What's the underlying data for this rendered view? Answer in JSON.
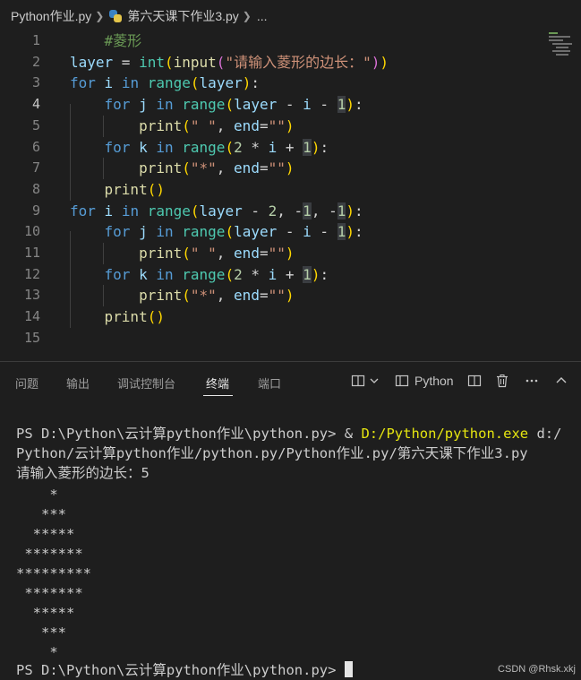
{
  "breadcrumb": {
    "folder": "Python作业.py",
    "file_icon": "python-file-icon",
    "file": "第六天课下作业3.py",
    "ellipsis": "..."
  },
  "editor": {
    "active_line": 4,
    "lines": [
      {
        "n": "1",
        "tokens": [
          [
            "    ",
            ""
          ],
          [
            "#菱形",
            "cm"
          ]
        ]
      },
      {
        "n": "2",
        "tokens": [
          [
            "layer",
            "var"
          ],
          [
            " = ",
            ""
          ],
          [
            "int",
            "bi"
          ],
          [
            "(",
            "br1"
          ],
          [
            "input",
            "fn"
          ],
          [
            "(",
            "br2"
          ],
          [
            "\"请输入菱形的边长：\"",
            "str"
          ],
          [
            ")",
            "br2"
          ],
          [
            ")",
            "br1"
          ]
        ]
      },
      {
        "n": "3",
        "tokens": [
          [
            "for",
            "kw"
          ],
          [
            " ",
            ""
          ],
          [
            "i",
            "var"
          ],
          [
            " ",
            ""
          ],
          [
            "in",
            "kw"
          ],
          [
            " ",
            ""
          ],
          [
            "range",
            "bi"
          ],
          [
            "(",
            "br1"
          ],
          [
            "layer",
            "var"
          ],
          [
            ")",
            "br1"
          ],
          [
            ":",
            ""
          ]
        ]
      },
      {
        "n": "4",
        "tokens": [
          [
            "    ",
            ""
          ],
          [
            "for",
            "kw"
          ],
          [
            " ",
            ""
          ],
          [
            "j",
            "var"
          ],
          [
            " ",
            ""
          ],
          [
            "in",
            "kw"
          ],
          [
            " ",
            ""
          ],
          [
            "range",
            "bi"
          ],
          [
            "(",
            "br1"
          ],
          [
            "layer",
            "var"
          ],
          [
            " - ",
            ""
          ],
          [
            "i",
            "var"
          ],
          [
            " - ",
            ""
          ],
          [
            "1",
            "num-hl num"
          ],
          [
            ")",
            "br1"
          ],
          [
            ":",
            ""
          ]
        ]
      },
      {
        "n": "5",
        "tokens": [
          [
            "        ",
            ""
          ],
          [
            "print",
            "fn"
          ],
          [
            "(",
            "br1"
          ],
          [
            "\" \"",
            "str"
          ],
          [
            ", ",
            ""
          ],
          [
            "end",
            "var"
          ],
          [
            "=",
            ""
          ],
          [
            "\"\"",
            "str"
          ],
          [
            ")",
            "br1"
          ]
        ]
      },
      {
        "n": "6",
        "tokens": [
          [
            "    ",
            ""
          ],
          [
            "for",
            "kw"
          ],
          [
            " ",
            ""
          ],
          [
            "k",
            "var"
          ],
          [
            " ",
            ""
          ],
          [
            "in",
            "kw"
          ],
          [
            " ",
            ""
          ],
          [
            "range",
            "bi"
          ],
          [
            "(",
            "br1"
          ],
          [
            "2",
            "num"
          ],
          [
            " * ",
            ""
          ],
          [
            "i",
            "var"
          ],
          [
            " + ",
            ""
          ],
          [
            "1",
            "num-hl num"
          ],
          [
            ")",
            "br1"
          ],
          [
            ":",
            ""
          ]
        ]
      },
      {
        "n": "7",
        "tokens": [
          [
            "        ",
            ""
          ],
          [
            "print",
            "fn"
          ],
          [
            "(",
            "br1"
          ],
          [
            "\"*\"",
            "str"
          ],
          [
            ", ",
            ""
          ],
          [
            "end",
            "var"
          ],
          [
            "=",
            ""
          ],
          [
            "\"\"",
            "str"
          ],
          [
            ")",
            "br1"
          ]
        ]
      },
      {
        "n": "8",
        "tokens": [
          [
            "    ",
            ""
          ],
          [
            "print",
            "fn"
          ],
          [
            "(",
            "br1"
          ],
          [
            ")",
            "br1"
          ]
        ]
      },
      {
        "n": "9",
        "tokens": [
          [
            "for",
            "kw"
          ],
          [
            " ",
            ""
          ],
          [
            "i",
            "var"
          ],
          [
            " ",
            ""
          ],
          [
            "in",
            "kw"
          ],
          [
            " ",
            ""
          ],
          [
            "range",
            "bi"
          ],
          [
            "(",
            "br1"
          ],
          [
            "layer",
            "var"
          ],
          [
            " - ",
            ""
          ],
          [
            "2",
            "num"
          ],
          [
            ", ",
            ""
          ],
          [
            "-",
            ""
          ],
          [
            "1",
            "num-hl num"
          ],
          [
            ", ",
            ""
          ],
          [
            "-",
            ""
          ],
          [
            "1",
            "num-hl num"
          ],
          [
            ")",
            "br1"
          ],
          [
            ":",
            ""
          ]
        ]
      },
      {
        "n": "10",
        "tokens": [
          [
            "    ",
            ""
          ],
          [
            "for",
            "kw"
          ],
          [
            " ",
            ""
          ],
          [
            "j",
            "var"
          ],
          [
            " ",
            ""
          ],
          [
            "in",
            "kw"
          ],
          [
            " ",
            ""
          ],
          [
            "range",
            "bi"
          ],
          [
            "(",
            "br1"
          ],
          [
            "layer",
            "var"
          ],
          [
            " - ",
            ""
          ],
          [
            "i",
            "var"
          ],
          [
            " - ",
            ""
          ],
          [
            "1",
            "num-hl num"
          ],
          [
            ")",
            "br1"
          ],
          [
            ":",
            ""
          ]
        ]
      },
      {
        "n": "11",
        "tokens": [
          [
            "        ",
            ""
          ],
          [
            "print",
            "fn"
          ],
          [
            "(",
            "br1"
          ],
          [
            "\" \"",
            "str"
          ],
          [
            ", ",
            ""
          ],
          [
            "end",
            "var"
          ],
          [
            "=",
            ""
          ],
          [
            "\"\"",
            "str"
          ],
          [
            ")",
            "br1"
          ]
        ]
      },
      {
        "n": "12",
        "tokens": [
          [
            "    ",
            ""
          ],
          [
            "for",
            "kw"
          ],
          [
            " ",
            ""
          ],
          [
            "k",
            "var"
          ],
          [
            " ",
            ""
          ],
          [
            "in",
            "kw"
          ],
          [
            " ",
            ""
          ],
          [
            "range",
            "bi"
          ],
          [
            "(",
            "br1"
          ],
          [
            "2",
            "num"
          ],
          [
            " * ",
            ""
          ],
          [
            "i",
            "var"
          ],
          [
            " + ",
            ""
          ],
          [
            "1",
            "num-hl num"
          ],
          [
            ")",
            "br1"
          ],
          [
            ":",
            ""
          ]
        ]
      },
      {
        "n": "13",
        "tokens": [
          [
            "        ",
            ""
          ],
          [
            "print",
            "fn"
          ],
          [
            "(",
            "br1"
          ],
          [
            "\"*\"",
            "str"
          ],
          [
            ", ",
            ""
          ],
          [
            "end",
            "var"
          ],
          [
            "=",
            ""
          ],
          [
            "\"\"",
            "str"
          ],
          [
            ")",
            "br1"
          ]
        ]
      },
      {
        "n": "14",
        "tokens": [
          [
            "    ",
            ""
          ],
          [
            "print",
            "fn"
          ],
          [
            "(",
            "br1"
          ],
          [
            ")",
            "br1"
          ]
        ]
      },
      {
        "n": "15",
        "tokens": []
      }
    ]
  },
  "panel": {
    "tabs": [
      "问题",
      "输出",
      "调试控制台",
      "终端",
      "端口"
    ],
    "active_tab": "终端",
    "terminal_type": "Python",
    "icons": [
      "split-layout-icon",
      "chevron-down-icon",
      "terminal-split-icon",
      "split-editor-icon",
      "trash-icon",
      "more-icon",
      "chevron-up-icon"
    ]
  },
  "terminal": {
    "prompt1": "PS D:\\Python\\云计算python作业\\python.py> ",
    "cmd_amp": "& ",
    "cmd_exe": "D:/Python/python.exe",
    "cmd_arg1": " d:/",
    "cmd_arg2": "Python/云计算python作业/python.py/Python作业.py/第六天课下作业3.py",
    "input_prompt": "请输入菱形的边长：5",
    "output": [
      "    *",
      "   ***",
      "  *****",
      " *******",
      "*********",
      " *******",
      "  *****",
      "   ***",
      "    *"
    ],
    "prompt2": "PS D:\\Python\\云计算python作业\\python.py> "
  },
  "watermark": "CSDN @Rhsk.xkj"
}
